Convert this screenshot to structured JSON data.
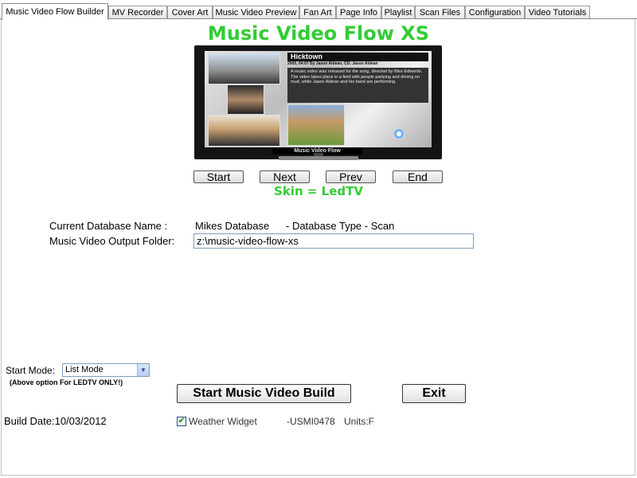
{
  "tabs": [
    {
      "label": "Music Video Flow Builder",
      "active": true
    },
    {
      "label": "MV Recorder"
    },
    {
      "label": "Cover Art"
    },
    {
      "label": "Music Video Preview"
    },
    {
      "label": "Fan Art"
    },
    {
      "label": "Page Info"
    },
    {
      "label": "Playlist"
    },
    {
      "label": "Scan Files"
    },
    {
      "label": "Configuration"
    },
    {
      "label": "Video Tutorials"
    }
  ],
  "title": "Music Video Flow XS",
  "preview": {
    "song_title": "Hicktown",
    "meta": "2005, 04:07 By Jason Aldean, CD: Jason Aldean",
    "description": "A music video was released for the song, directed by Wes Edwards. The video takes place in a field with people partying and driving on mud, while Jason Aldean and his band are performing.",
    "tv_label": "Music Video Flow"
  },
  "nav": {
    "start": "Start",
    "next": "Next",
    "prev": "Prev",
    "end": "End"
  },
  "skin_text": "Skin = LedTV",
  "database": {
    "name_label": "Current Database Name :",
    "name_value": "Mikes Database",
    "type_text": "- Database Type - Scan"
  },
  "output_folder": {
    "label": "Music Video Output Folder:",
    "value": "z:\\music-video-flow-xs"
  },
  "start_mode": {
    "label": "Start Mode:",
    "selected": "List Mode",
    "note": "(Above option For LEDTV ONLY!)"
  },
  "buttons": {
    "build": "Start Music Video Build",
    "exit": "Exit"
  },
  "footer": {
    "build_date": "Build Date:10/03/2012",
    "weather_label": "Weather Widget",
    "weather_checked": true,
    "location": "-USMI0478",
    "units": "Units:F"
  },
  "colors": {
    "accent": "#33cc33",
    "tv_frame": "#141414"
  }
}
